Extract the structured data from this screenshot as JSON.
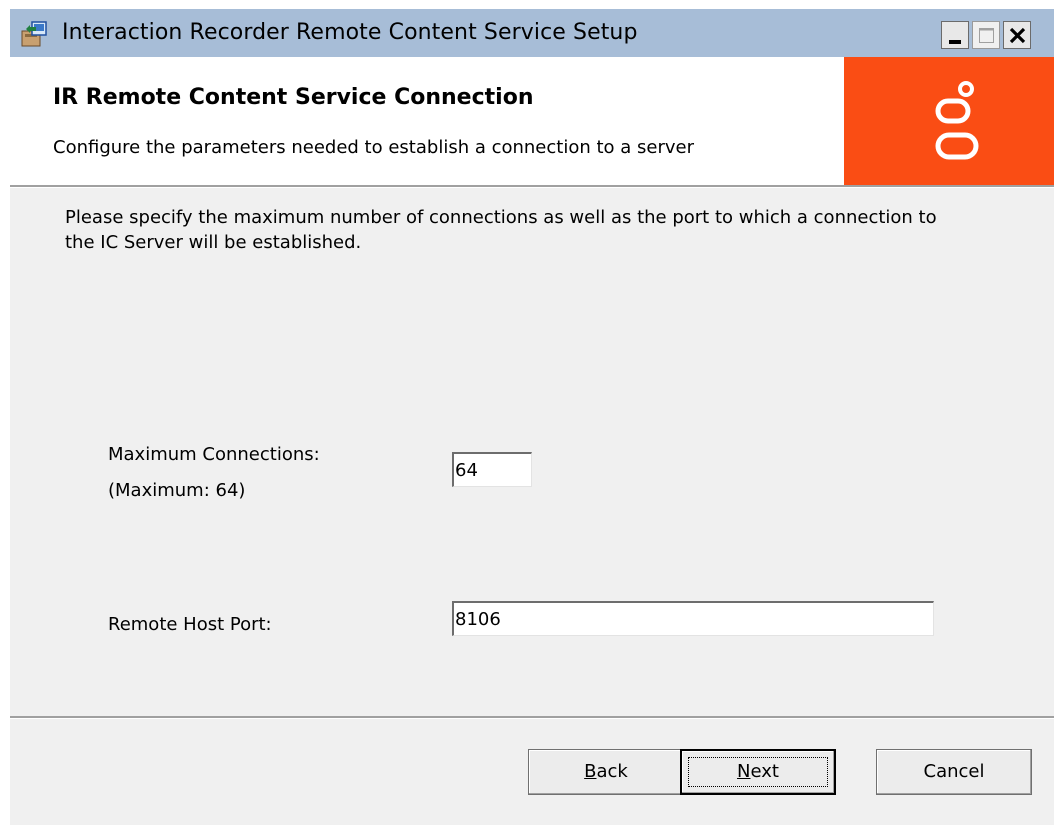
{
  "window": {
    "title": "Interaction Recorder Remote Content Service Setup",
    "icon": "installer-package-icon",
    "controls": {
      "minimize": "minimize-icon",
      "maximize": "maximize-icon",
      "close": "close-icon"
    }
  },
  "header": {
    "title": "IR Remote Content Service Connection",
    "subtitle": "Configure the parameters needed to establish a connection to a server",
    "logo": "genesys-logo",
    "logo_color": "#fa4d14"
  },
  "body": {
    "description": "Please specify the maximum number of connections as well as the port to which a connection to the IC Server will be established.",
    "max_connections": {
      "label": "Maximum Connections:",
      "hint": "(Maximum: 64)",
      "value": "64"
    },
    "remote_host_port": {
      "label": "Remote Host Port:",
      "value": "8106"
    }
  },
  "footer": {
    "back": {
      "mnemonic": "B",
      "rest": "ack"
    },
    "next": {
      "mnemonic": "N",
      "rest": "ext"
    },
    "cancel": "Cancel"
  },
  "colors": {
    "titlebar": "#a7bdd7",
    "dialog_background": "#f0f0f0",
    "header_background": "#ffffff"
  }
}
